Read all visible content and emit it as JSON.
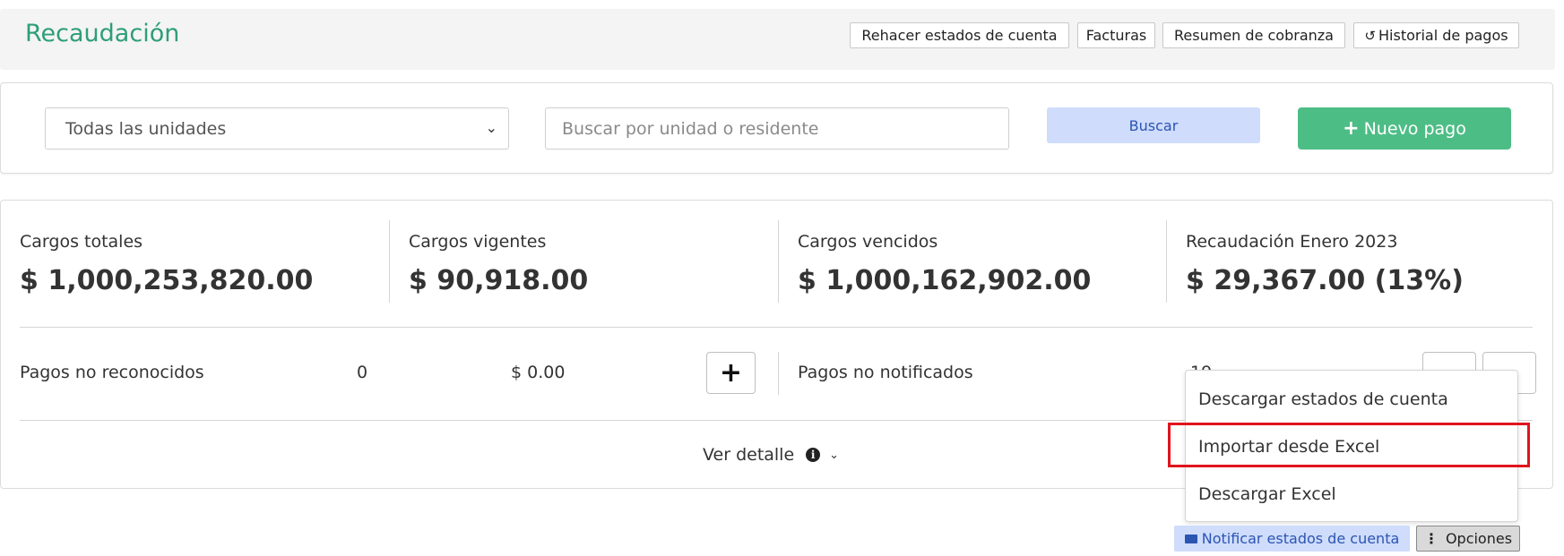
{
  "header": {
    "title": "Recaudación",
    "buttons": {
      "rehacer": "Rehacer estados de cuenta",
      "facturas": "Facturas",
      "resumen": "Resumen de cobranza",
      "historial": "Historial de pagos"
    }
  },
  "filters": {
    "unit_select_value": "Todas las unidades",
    "search_placeholder": "Buscar por unidad o residente",
    "search_label": "Buscar",
    "new_payment_label": "Nuevo pago"
  },
  "stats": [
    {
      "label": "Cargos totales",
      "value": "$ 1,000,253,820.00"
    },
    {
      "label": "Cargos vigentes",
      "value": "$ 90,918.00"
    },
    {
      "label": "Cargos vencidos",
      "value": "$ 1,000,162,902.00"
    },
    {
      "label": "Recaudación Enero 2023",
      "value": "$ 29,367.00 (13%)"
    }
  ],
  "unrecognized": {
    "label": "Pagos no reconocidos",
    "count": "0",
    "amount": "$ 0.00"
  },
  "unnotified": {
    "label": "Pagos no notificados",
    "count_partial": "19"
  },
  "detail": {
    "label": "Ver detalle"
  },
  "dropdown": {
    "items": [
      "Descargar estados de cuenta",
      "Importar desde Excel",
      "Descargar Excel"
    ]
  },
  "footer": {
    "notify_label": "Notificar estados de cuenta",
    "options_label": "Opciones"
  },
  "colors": {
    "brand_green": "#2e9e78",
    "new_button_green": "#4dbd86",
    "search_button_bg": "#cfdcfb",
    "highlight_red": "#e0141e"
  }
}
